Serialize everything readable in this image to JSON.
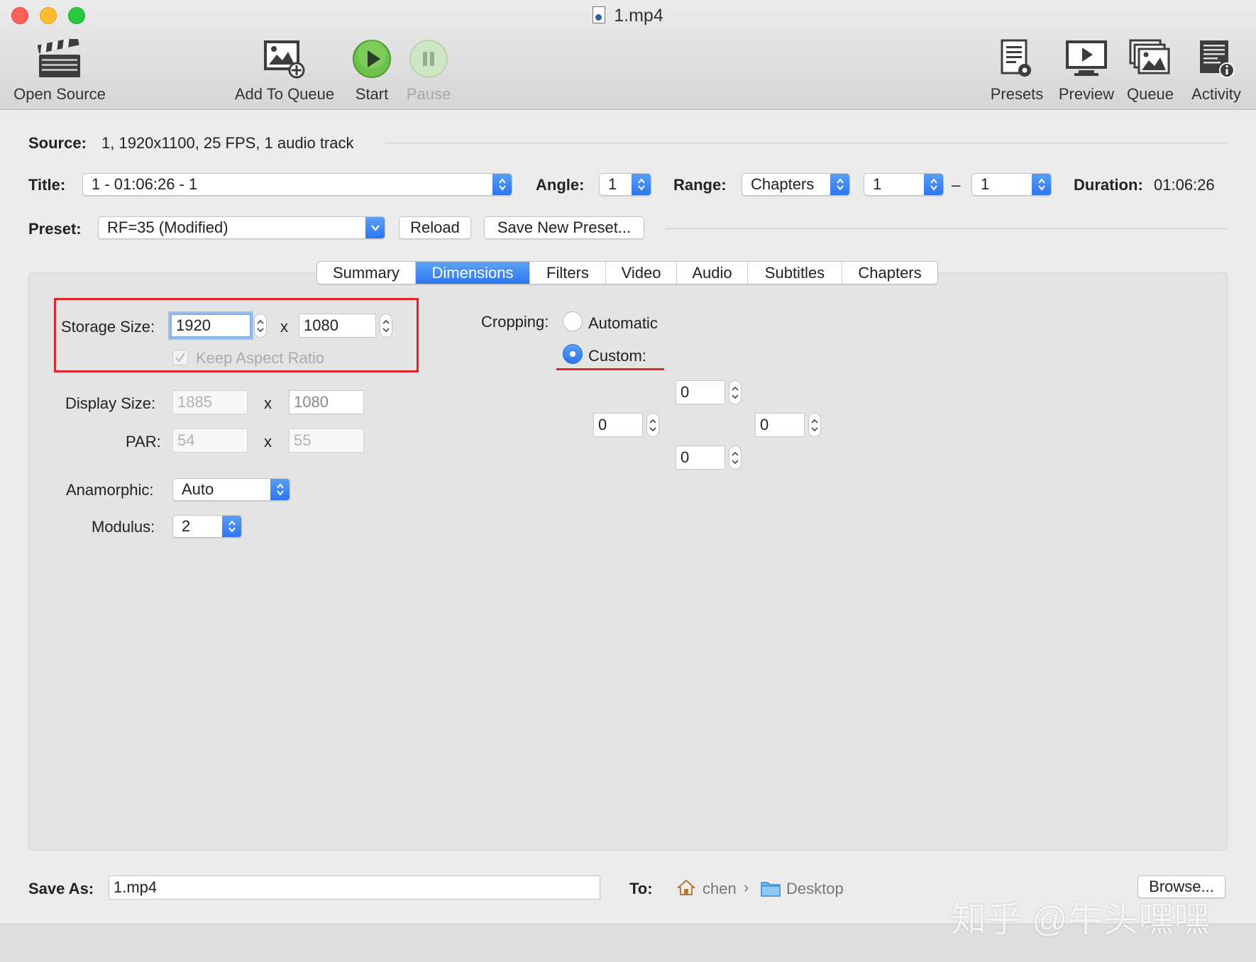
{
  "window": {
    "title": "1.mp4"
  },
  "toolbar": {
    "open_source": "Open Source",
    "add_to_queue": "Add To Queue",
    "start": "Start",
    "pause": "Pause",
    "presets": "Presets",
    "preview": "Preview",
    "queue": "Queue",
    "activity": "Activity"
  },
  "source": {
    "label": "Source:",
    "value": "1, 1920x1100, 25 FPS, 1 audio track"
  },
  "title_row": {
    "title_label": "Title:",
    "title_value": "1 - 01:06:26 - 1",
    "angle_label": "Angle:",
    "angle_value": "1",
    "range_label": "Range:",
    "range_value": "Chapters",
    "range_start": "1",
    "range_dash": "–",
    "range_end": "1",
    "duration_label": "Duration:",
    "duration_value": "01:06:26"
  },
  "preset_row": {
    "label": "Preset:",
    "value": "RF=35 (Modified)",
    "reload": "Reload",
    "save_new": "Save New Preset..."
  },
  "tabs": [
    "Summary",
    "Dimensions",
    "Filters",
    "Video",
    "Audio",
    "Subtitles",
    "Chapters"
  ],
  "active_tab": "Dimensions",
  "dimensions": {
    "storage_label": "Storage Size:",
    "storage_w": "1920",
    "storage_h": "1080",
    "x": "x",
    "keep_aspect": "Keep Aspect Ratio",
    "display_label": "Display Size:",
    "display_w": "1885",
    "display_h": "1080",
    "par_label": "PAR:",
    "par_w": "54",
    "par_h": "55",
    "anamorphic_label": "Anamorphic:",
    "anamorphic_value": "Auto",
    "modulus_label": "Modulus:",
    "modulus_value": "2"
  },
  "cropping": {
    "label": "Cropping:",
    "automatic": "Automatic",
    "custom": "Custom:",
    "selected": "custom",
    "top": "0",
    "left": "0",
    "right": "0",
    "bottom": "0"
  },
  "save": {
    "label": "Save As:",
    "value": "1.mp4",
    "to_label": "To:",
    "path_user": "chen",
    "path_sep": "›",
    "path_folder": "Desktop",
    "browse": "Browse..."
  },
  "watermark": "知乎 @牛头嘿嘿",
  "colors": {
    "accent": "#2a74ef",
    "highlight": "#e0262b",
    "start_green": "#5cb83a"
  }
}
